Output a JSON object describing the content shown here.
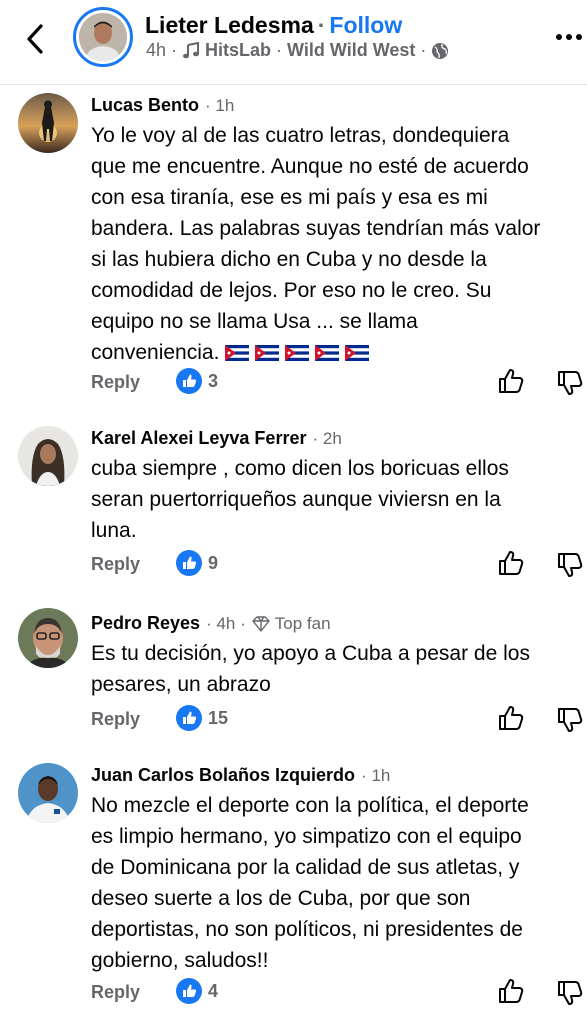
{
  "header": {
    "author": "Lieter Ledesma",
    "separator": "·",
    "follow": "Follow",
    "time": "4h",
    "meta_dot": "·",
    "music": "HitsLab",
    "song": "Wild Wild West",
    "privacy_icon": "globe-icon"
  },
  "comments": [
    {
      "name": "Lucas Bento",
      "time": "1h",
      "text": "Yo le voy al de las cuatro letras, dondequiera\nque me encuentre. Aunque no esté de acuerdo\ncon esa tiranía, ese es mi país y esa es mi\nbandera. Las palabras suyas tendrían más valor\nsi las hubiera dicho en Cuba y no desde la\ncomodidad de lejos. Por eso no le creo. Su\nequipo no se llama Usa ... se llama\nconveniencia.",
      "flags": "🇨🇺🇨🇺🇨🇺🇨🇺🇨🇺",
      "reply": "Reply",
      "likes": "3"
    },
    {
      "name": "Karel Alexei Leyva Ferrer",
      "time": "2h",
      "text": "cuba siempre , como dicen los boricuas ellos\nseran puertorriqueños aunque viviersn en la\nluna.",
      "reply": "Reply",
      "likes": "9"
    },
    {
      "name": "Pedro Reyes",
      "time": "4h",
      "badge": "Top fan",
      "text": "Es tu decisión, yo apoyo a Cuba a pesar de los\npesares, un abrazo",
      "reply": "Reply",
      "likes": "15"
    },
    {
      "name": "Juan Carlos Bolaños Izquierdo",
      "time": "1h",
      "text": "No mezcle el deporte con la política, el deporte\nes limpio hermano, yo simpatizo con el equipo\nde Dominicana por la calidad de sus atletas, y\ndeseo suerte a los de Cuba, por que son\ndeportistas, no son políticos, ni presidentes de\ngobierno, saludos!!",
      "reply": "Reply",
      "likes": "4"
    }
  ],
  "colors": {
    "accent": "#1877f2",
    "secondary_text": "#65676b"
  }
}
